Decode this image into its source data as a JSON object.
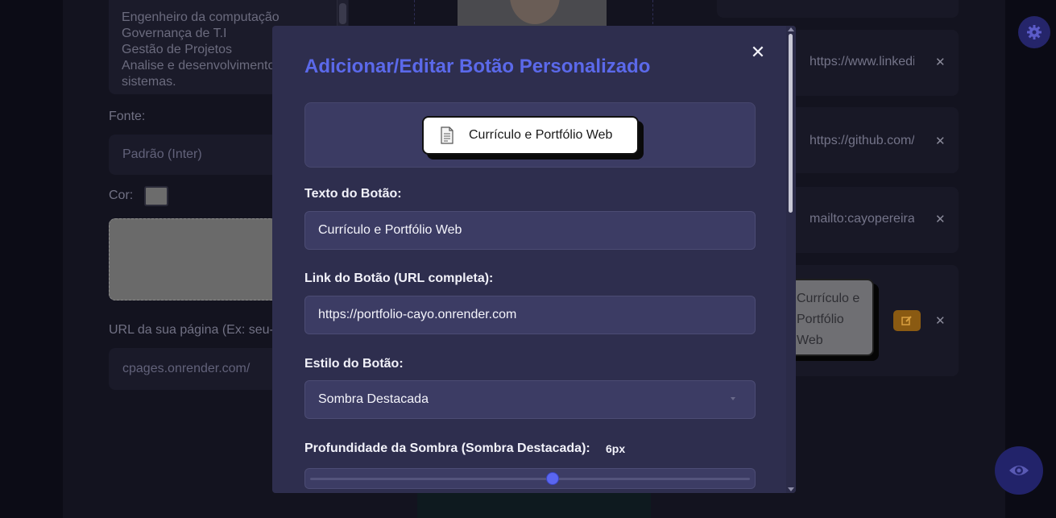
{
  "background": {
    "bio_lines": [
      "Engenheiro da computação",
      "Governança de T.I",
      "Gestão de Projetos",
      "Analise e desenvolvimento de",
      "sistemas."
    ],
    "font_label": "Fonte:",
    "font_value": "Padrão (Inter)",
    "color_label": "Cor:",
    "url_label": "URL da sua página (Ex: seu-nome.onrender.com):",
    "url_value": "cpages.onrender.com/",
    "links": [
      {
        "text": "https://www.linkedin.com/in/cayo"
      },
      {
        "text": "https://github.com/cayo"
      },
      {
        "text": "mailto:cayopereira@email.com"
      }
    ],
    "preview_button_lines": [
      "Currículo e",
      "Portfólio",
      "Web"
    ],
    "remove_symbol": "✕"
  },
  "modal": {
    "title": "Adicionar/Editar Botão Personalizado",
    "close_symbol": "✕",
    "preview_text": "Currículo e Portfólio Web",
    "text_label": "Texto do Botão:",
    "text_value": "Currículo e Portfólio Web",
    "link_label": "Link do Botão (URL completa):",
    "link_value": "https://portfolio-cayo.onrender.com",
    "style_label": "Estilo do Botão:",
    "style_value": "Sombra Destacada",
    "depth_label": "Profundidade da Sombra (Sombra Destacada):",
    "depth_value": "6px",
    "depth_fraction": 0.55
  },
  "colors": {
    "accent": "#5b69ea",
    "modal_bg": "#2e2e4e",
    "edit_orange": "#8a5a12"
  }
}
